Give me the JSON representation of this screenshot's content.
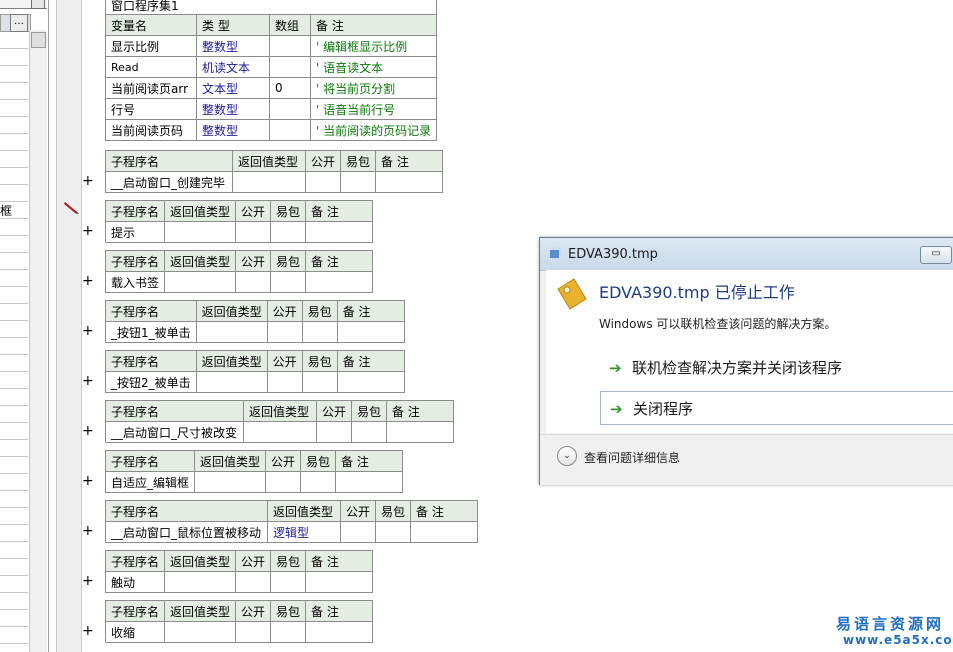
{
  "left_panel": {
    "ellipsis_label": "…",
    "row_text": "框"
  },
  "vars_table": {
    "title": "窗口程序集1",
    "headers": [
      "变量名",
      "类 型",
      "数组",
      "备 注"
    ],
    "rows": [
      [
        "显示比例",
        "整数型",
        "",
        "' 编辑框显示比例"
      ],
      [
        "Read",
        "机读文本",
        "",
        "' 语音读文本"
      ],
      [
        "当前阅读页arr",
        "文本型",
        "0",
        "' 将当前页分割"
      ],
      [
        "行号",
        "整数型",
        "",
        "' 语音当前行号"
      ],
      [
        "当前阅读页码",
        "整数型",
        "",
        "' 当前阅读的页码记录"
      ]
    ]
  },
  "sub_headers": {
    "name": "子程序名",
    "return_type": "返回值类型",
    "public": "公开",
    "easy_pack": "易包",
    "remark": "备 注"
  },
  "subroutines": [
    {
      "name": "__启动窗口_创建完毕",
      "return_type": ""
    },
    {
      "name": "提示",
      "return_type": ""
    },
    {
      "name": "载入书签",
      "return_type": ""
    },
    {
      "name": "_按钮1_被单击",
      "return_type": ""
    },
    {
      "name": "_按钮2_被单击",
      "return_type": ""
    },
    {
      "name": "__启动窗口_尺寸被改变",
      "return_type": ""
    },
    {
      "name": "自适应_编辑框",
      "return_type": ""
    },
    {
      "name": "__启动窗口_鼠标位置被移动",
      "return_type": "逻辑型"
    },
    {
      "name": "触动",
      "return_type": ""
    },
    {
      "name": "收缩",
      "return_type": ""
    }
  ],
  "gutter": {
    "expand_symbol": "+",
    "pencil_icon": "pencil-icon"
  },
  "dialog": {
    "title": "EDVA390.tmp",
    "minimize_symbol": "▭",
    "headline": "EDVA390.tmp 已停止工作",
    "description": "Windows 可以联机检查该问题的解决方案。",
    "option1": "联机检查解决方案并关闭该程序",
    "option2": "关闭程序",
    "details_label": "查看问题详细信息",
    "arrow_symbol": "➔",
    "details_symbol": "⌄"
  },
  "watermark": {
    "line1": "易语言资源网",
    "line2": "www.e5a5x.com"
  },
  "colors": {
    "header_bg": "#e3ede2",
    "type_text": "#1a1a9c",
    "comment_text": "#0a7a0a",
    "dialog_headline": "#1d3d86",
    "watermark": "#1f6fc6"
  }
}
